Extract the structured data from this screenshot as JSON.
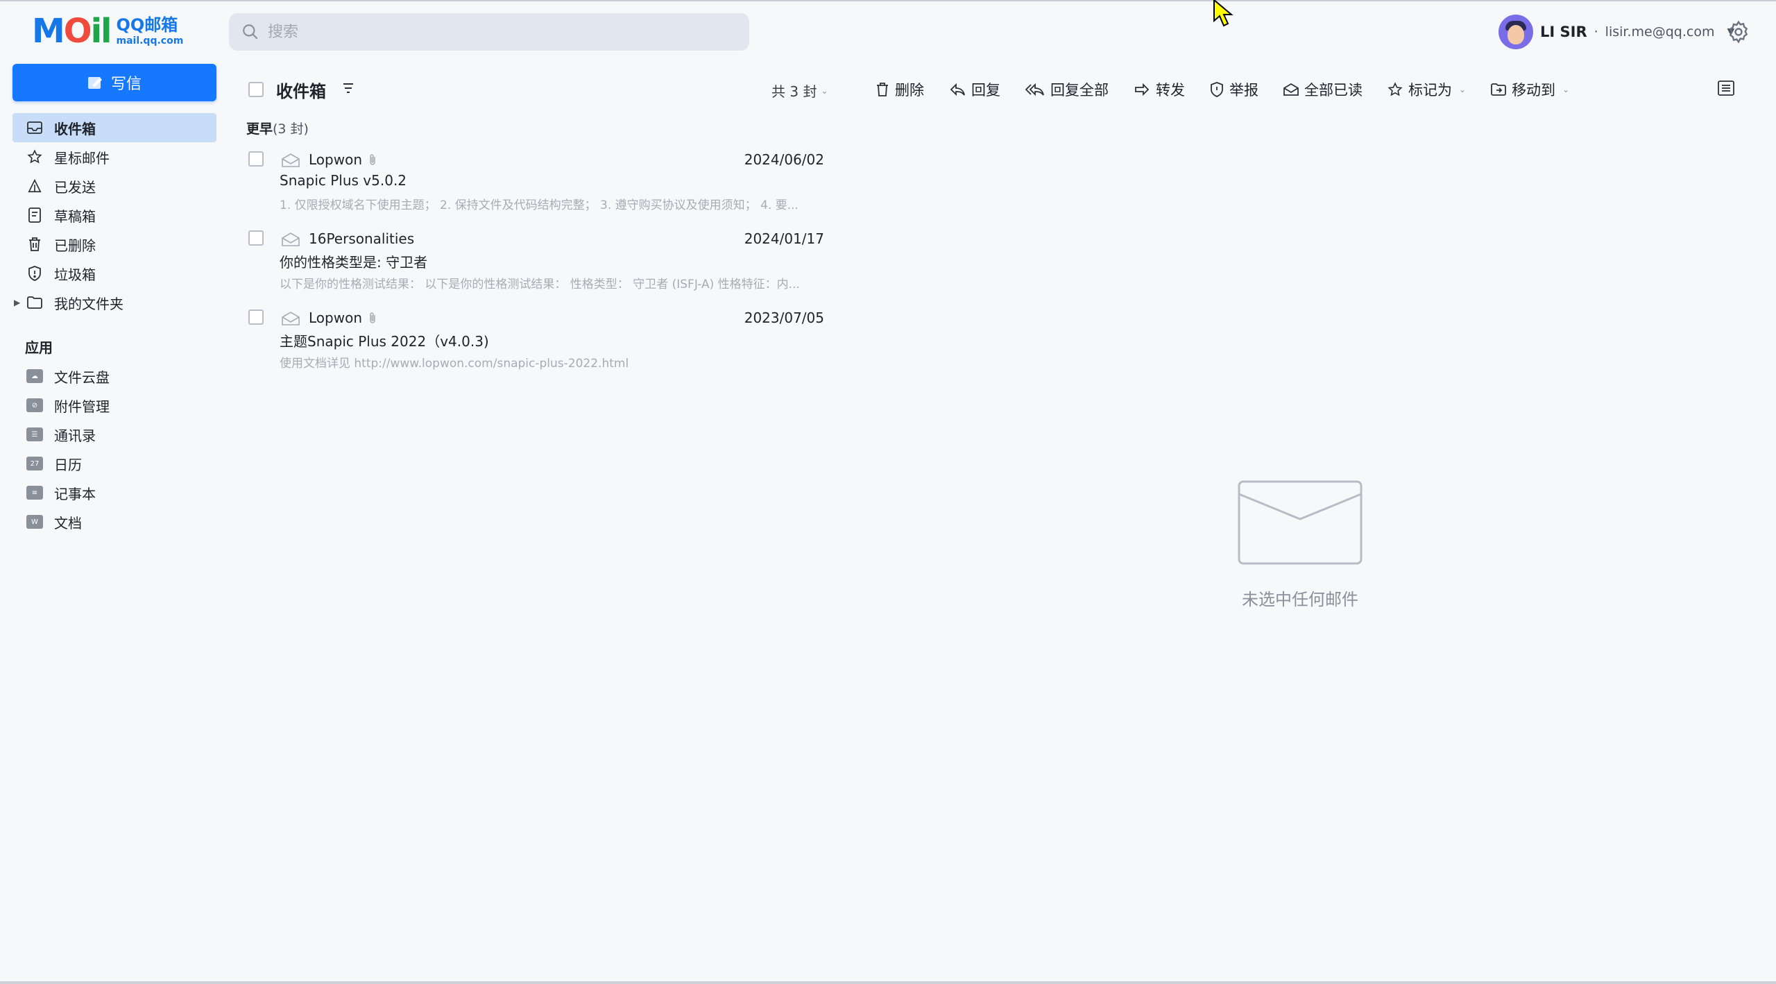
{
  "app": {
    "logo_text": "MOil",
    "logo_brand": "QQ邮箱",
    "logo_domain": "mail.qq.com"
  },
  "search": {
    "placeholder": "搜索"
  },
  "user": {
    "name": "LI SIR",
    "email": "lisir.me@qq.com",
    "separator": "·"
  },
  "compose": {
    "label": "写信"
  },
  "nav": [
    {
      "label": "收件箱",
      "icon": "inbox-icon",
      "active": true
    },
    {
      "label": "星标邮件",
      "icon": "star-icon"
    },
    {
      "label": "已发送",
      "icon": "sent-icon"
    },
    {
      "label": "草稿箱",
      "icon": "draft-icon"
    },
    {
      "label": "已删除",
      "icon": "trash-icon"
    },
    {
      "label": "垃圾箱",
      "icon": "shield-icon"
    },
    {
      "label": "我的文件夹",
      "icon": "folder-icon",
      "expandable": true
    }
  ],
  "apps": {
    "title": "应用",
    "items": [
      {
        "label": "文件云盘",
        "icon": "cloud-drive-icon"
      },
      {
        "label": "附件管理",
        "icon": "attachment-manager-icon"
      },
      {
        "label": "通讯录",
        "icon": "contacts-icon"
      },
      {
        "label": "日历",
        "icon": "calendar-icon",
        "glyph": "27"
      },
      {
        "label": "记事本",
        "icon": "notepad-icon"
      },
      {
        "label": "文档",
        "icon": "docs-icon",
        "glyph": "W"
      }
    ]
  },
  "list": {
    "folder_title": "收件箱",
    "total": "共 3 封",
    "group": {
      "name": "更早",
      "count": "(3 封)"
    }
  },
  "toolbar": {
    "delete": "删除",
    "reply": "回复",
    "reply_all": "回复全部",
    "forward": "转发",
    "report": "举报",
    "mark_all_read": "全部已读",
    "mark_as": "标记为",
    "move_to": "移动到"
  },
  "mails": [
    {
      "from": "Lopwon",
      "has_attachment": true,
      "date": "2024/06/02",
      "subject": "Snapic Plus v5.0.2",
      "preview": "1. 仅限授权域名下使用主题； 2. 保持文件及代码结构完整； 3. 遵守购买协议及使用须知； 4. 要..."
    },
    {
      "from": "16Personalities",
      "has_attachment": false,
      "date": "2024/01/17",
      "subject": "你的性格类型是: 守卫者",
      "preview": "以下是你的性格测试结果： 以下是你的性格测试结果： 性格类型： 守卫者 (ISFJ-A) 性格特征：内..."
    },
    {
      "from": "Lopwon",
      "has_attachment": true,
      "date": "2023/07/05",
      "subject": "主题Snapic Plus 2022（v4.0.3)",
      "preview": "使用文档详见 http://www.lopwon.com/snapic-plus-2022.html"
    }
  ],
  "empty_state": {
    "text": "未选中任何邮件"
  },
  "colors": {
    "accent": "#1677ff",
    "active_bg": "#c8ddf7",
    "background": "#f7f8fa"
  }
}
